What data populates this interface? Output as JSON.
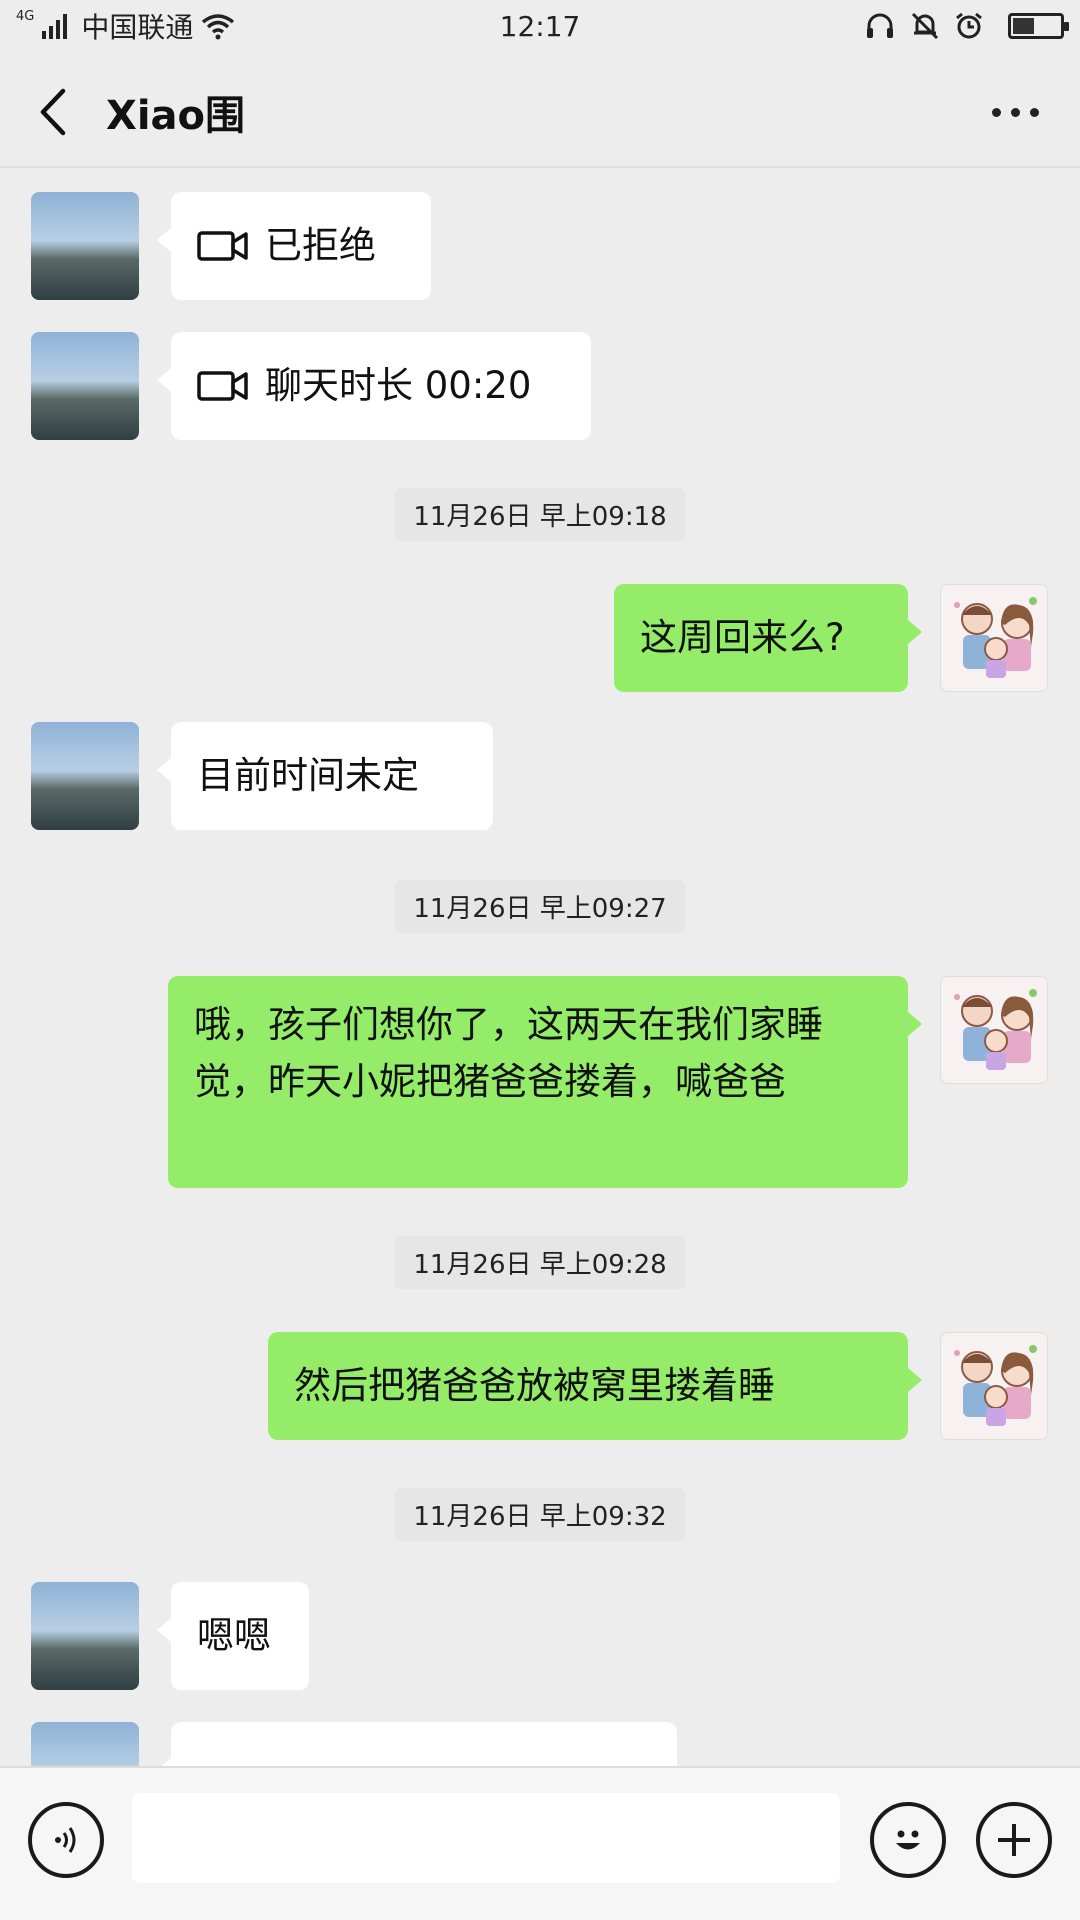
{
  "status_bar": {
    "network_gen": "4G",
    "carrier": "中国联通",
    "time": "12:17",
    "battery_level": 0.45
  },
  "header": {
    "title": "Xiao围"
  },
  "messages": [
    {
      "side": "left",
      "type": "video-call",
      "text": "已拒绝"
    },
    {
      "side": "left",
      "type": "video-call",
      "text": "聊天时长 00:20"
    },
    {
      "type": "timestamp",
      "text": "11月26日 早上09:18"
    },
    {
      "side": "right",
      "type": "text",
      "text": "这周回来么?"
    },
    {
      "side": "left",
      "type": "text",
      "text": "目前时间未定"
    },
    {
      "type": "timestamp",
      "text": "11月26日 早上09:27"
    },
    {
      "side": "right",
      "type": "text",
      "text": "哦，孩子们想你了，这两天在我们家睡觉，昨天小妮把猪爸爸搂着，喊爸爸"
    },
    {
      "type": "timestamp",
      "text": "11月26日 早上09:28"
    },
    {
      "side": "right",
      "type": "text",
      "text": "然后把猪爸爸放被窝里搂着睡"
    },
    {
      "type": "timestamp",
      "text": "11月26日 早上09:32"
    },
    {
      "side": "left",
      "type": "text",
      "text": "嗯嗯"
    }
  ],
  "colors": {
    "background": "#ededed",
    "bubble_self": "#95ec69",
    "bubble_other": "#ffffff"
  }
}
